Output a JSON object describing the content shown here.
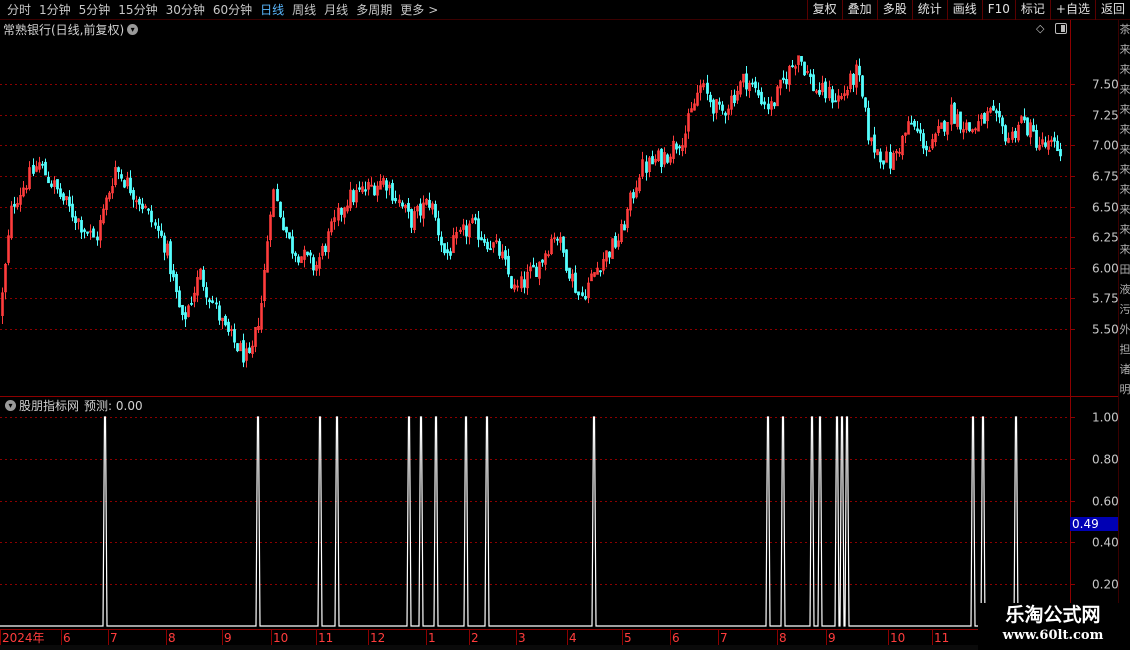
{
  "toolbar": {
    "period_tabs": [
      "分时",
      "1分钟",
      "5分钟",
      "15分钟",
      "30分钟",
      "60分钟",
      "日线",
      "周线",
      "月线",
      "多周期",
      "更多"
    ],
    "active_tab": "日线",
    "more_arrow": ">",
    "right_buttons": [
      "复权",
      "叠加",
      "多股",
      "统计",
      "画线",
      "F10",
      "标记",
      "+自选",
      "返回"
    ]
  },
  "main_panel": {
    "title": "常熟银行(日线,前复权)",
    "price_axis_labels": [
      "7.50",
      "7.25",
      "7.00",
      "6.75",
      "6.50",
      "6.25",
      "6.00",
      "5.75",
      "5.50"
    ]
  },
  "indicator_panel": {
    "title": "股朋指标网",
    "value_label": "预测: 0.00",
    "axis_labels": [
      "1.00",
      "0.80",
      "0.60",
      "0.40",
      "0.20"
    ],
    "cursor_value": "0.49",
    "cursor_color": "#0000b4"
  },
  "date_axis": {
    "labels": [
      "2024年",
      "6",
      "7",
      "8",
      "9",
      "10",
      "11",
      "12",
      "1",
      "2",
      "3",
      "4",
      "5",
      "6",
      "7",
      "8",
      "9",
      "10",
      "11"
    ]
  },
  "sidebar": {
    "chars": [
      "茶",
      "来",
      "来",
      "来",
      "来",
      "来",
      "来",
      "来",
      "来",
      "来",
      "来",
      "来",
      "田",
      "液",
      "污",
      "外",
      "担",
      "诸",
      "明"
    ]
  },
  "watermark": {
    "title": "乐淘公式网",
    "url": "www.60lt.com"
  },
  "colors": {
    "up": "#ff3c3c",
    "down": "#54ffff",
    "grid": "#8c0000",
    "signal": "#ffffff",
    "axis_text": "#c8c8c8"
  },
  "chart_data": [
    {
      "type": "candlestick",
      "title": "常熟银行(日线,前复权)",
      "y_tick_labels": [
        "7.50",
        "7.25",
        "7.00",
        "6.75",
        "6.50",
        "6.25",
        "6.00",
        "5.75",
        "5.50"
      ],
      "ylim": [
        5.25,
        7.9
      ],
      "x_month_labels": [
        "2024年",
        "6",
        "7",
        "8",
        "9",
        "10",
        "11",
        "12",
        "1",
        "2",
        "3",
        "4",
        "5",
        "6",
        "7",
        "8",
        "9",
        "10",
        "11"
      ],
      "grid": true,
      "approx_close_path": [
        [
          0,
          5.62
        ],
        [
          12,
          6.52
        ],
        [
          38,
          6.85
        ],
        [
          70,
          6.47
        ],
        [
          95,
          6.22
        ],
        [
          115,
          6.82
        ],
        [
          140,
          6.55
        ],
        [
          165,
          6.18
        ],
        [
          182,
          5.55
        ],
        [
          200,
          5.95
        ],
        [
          225,
          5.48
        ],
        [
          250,
          5.22
        ],
        [
          262,
          5.75
        ],
        [
          272,
          6.65
        ],
        [
          290,
          6.18
        ],
        [
          315,
          6.0
        ],
        [
          345,
          6.55
        ],
        [
          385,
          6.72
        ],
        [
          410,
          6.38
        ],
        [
          430,
          6.55
        ],
        [
          445,
          6.1
        ],
        [
          470,
          6.35
        ],
        [
          500,
          6.12
        ],
        [
          515,
          5.8
        ],
        [
          540,
          6.05
        ],
        [
          555,
          6.3
        ],
        [
          580,
          5.75
        ],
        [
          600,
          6.05
        ],
        [
          620,
          6.25
        ],
        [
          640,
          6.8
        ],
        [
          665,
          6.92
        ],
        [
          685,
          7.1
        ],
        [
          700,
          7.48
        ],
        [
          720,
          7.25
        ],
        [
          745,
          7.55
        ],
        [
          770,
          7.3
        ],
        [
          785,
          7.55
        ],
        [
          798,
          7.75
        ],
        [
          815,
          7.45
        ],
        [
          840,
          7.38
        ],
        [
          857,
          7.6
        ],
        [
          870,
          7.02
        ],
        [
          890,
          6.85
        ],
        [
          910,
          7.18
        ],
        [
          930,
          6.95
        ],
        [
          950,
          7.28
        ],
        [
          970,
          7.12
        ],
        [
          990,
          7.25
        ],
        [
          1010,
          7.05
        ],
        [
          1020,
          7.22
        ],
        [
          1040,
          7.0
        ],
        [
          1062,
          6.97
        ]
      ]
    },
    {
      "type": "line",
      "title": "股朋指标网",
      "y_tick_labels": [
        "1.00",
        "0.80",
        "0.60",
        "0.40",
        "0.20"
      ],
      "ylim": [
        0,
        1.05
      ],
      "series": [
        {
          "name": "预测",
          "baseline": 0,
          "spike_value": 1.0,
          "spike_x": [
            105,
            258,
            320,
            337,
            409,
            421,
            436,
            466,
            487,
            594,
            768,
            783,
            812,
            820,
            837,
            842,
            847,
            973,
            983,
            1016
          ]
        }
      ]
    }
  ]
}
